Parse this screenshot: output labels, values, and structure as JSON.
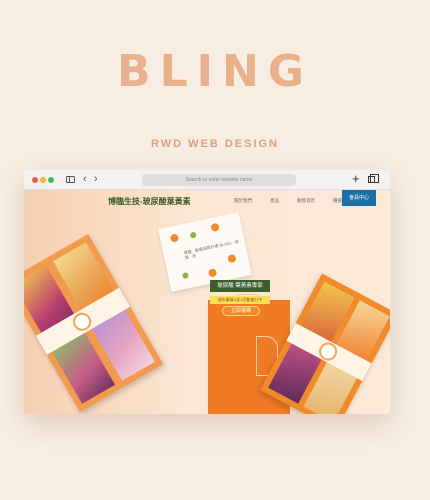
{
  "page": {
    "brand_title": "BLING",
    "subtitle": "RWD WEB DESIGN"
  },
  "browser": {
    "address_placeholder": "Search or enter website name",
    "new_tab_symbol": "+",
    "back_symbol": "‹",
    "forward_symbol": "›"
  },
  "site": {
    "title": "博臨生技-玻尿酸葉黃素",
    "nav": [
      "關於我們",
      "產品",
      "動態消息",
      "購買資訊"
    ],
    "member_button": "會員中心",
    "paper_text": "博臨 · 動感亮眼計畫 BLING ‧ 玻 ‧ 葉 · 亮",
    "hero_badge": "玻尿酸 葉黃素專家",
    "cta_line": "週年慶買2送1活動進行中",
    "cta_button": "立即選購"
  },
  "colors": {
    "brand": "#e9b08c",
    "site_title": "#3d5b2a",
    "member_button": "#1e6fa6",
    "accent_orange": "#f07a26"
  }
}
